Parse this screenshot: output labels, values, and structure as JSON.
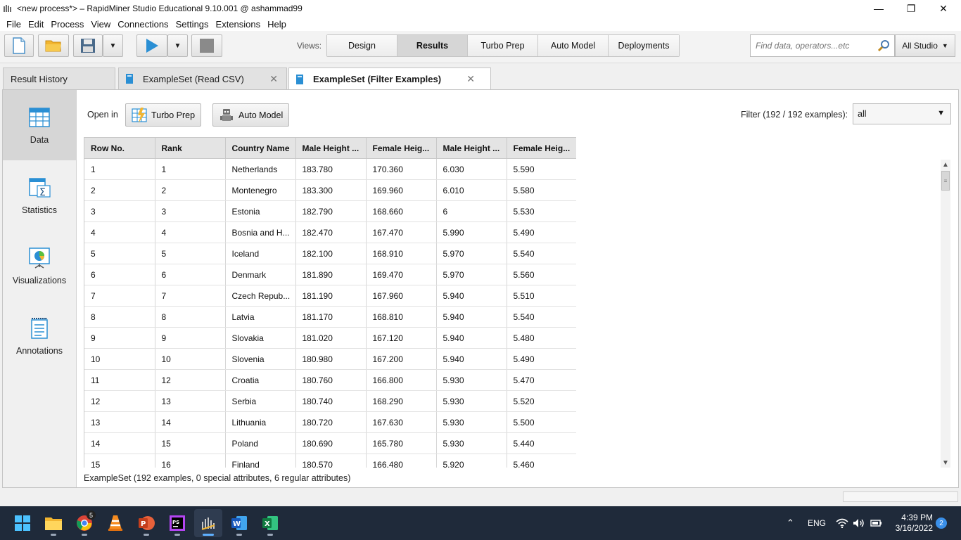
{
  "window": {
    "title": "<new process*> – RapidMiner Studio Educational 9.10.001 @ ashammad99",
    "minimize_glyph": "—",
    "restore_glyph": "❐",
    "close_glyph": "✕"
  },
  "menu": {
    "file": "File",
    "edit": "Edit",
    "process": "Process",
    "view": "View",
    "connections": "Connections",
    "settings": "Settings",
    "extensions": "Extensions",
    "help": "Help"
  },
  "toolbar": {
    "views_label": "Views:",
    "views": [
      "Design",
      "Results",
      "Turbo Prep",
      "Auto Model",
      "Deployments"
    ],
    "active_view": "Results",
    "search_placeholder": "Find data, operators...etc",
    "scope": "All Studio"
  },
  "tabs": {
    "result_history": "Result History",
    "read_csv": "ExampleSet (Read CSV)",
    "filter_examples": "ExampleSet (Filter Examples)"
  },
  "sidenav": {
    "data": "Data",
    "statistics": "Statistics",
    "visualizations": "Visualizations",
    "annotations": "Annotations"
  },
  "actions": {
    "open_in": "Open in",
    "turbo_prep": "Turbo Prep",
    "auto_model": "Auto Model",
    "filter_label": "Filter (192 / 192 examples):",
    "filter_value": "all"
  },
  "table": {
    "columns": [
      "Row No.",
      "Rank",
      "Country Name",
      "Male Height ...",
      "Female Heig...",
      "Male Height ...",
      "Female Heig..."
    ],
    "rows": [
      [
        "1",
        "1",
        "Netherlands",
        "183.780",
        "170.360",
        "6.030",
        "5.590"
      ],
      [
        "2",
        "2",
        "Montenegro",
        "183.300",
        "169.960",
        "6.010",
        "5.580"
      ],
      [
        "3",
        "3",
        "Estonia",
        "182.790",
        "168.660",
        "6",
        "5.530"
      ],
      [
        "4",
        "4",
        "Bosnia and H...",
        "182.470",
        "167.470",
        "5.990",
        "5.490"
      ],
      [
        "5",
        "5",
        "Iceland",
        "182.100",
        "168.910",
        "5.970",
        "5.540"
      ],
      [
        "6",
        "6",
        "Denmark",
        "181.890",
        "169.470",
        "5.970",
        "5.560"
      ],
      [
        "7",
        "7",
        "Czech Repub...",
        "181.190",
        "167.960",
        "5.940",
        "5.510"
      ],
      [
        "8",
        "8",
        "Latvia",
        "181.170",
        "168.810",
        "5.940",
        "5.540"
      ],
      [
        "9",
        "9",
        "Slovakia",
        "181.020",
        "167.120",
        "5.940",
        "5.480"
      ],
      [
        "10",
        "10",
        "Slovenia",
        "180.980",
        "167.200",
        "5.940",
        "5.490"
      ],
      [
        "11",
        "12",
        "Croatia",
        "180.760",
        "166.800",
        "5.930",
        "5.470"
      ],
      [
        "12",
        "13",
        "Serbia",
        "180.740",
        "168.290",
        "5.930",
        "5.520"
      ],
      [
        "13",
        "14",
        "Lithuania",
        "180.720",
        "167.630",
        "5.930",
        "5.500"
      ],
      [
        "14",
        "15",
        "Poland",
        "180.690",
        "165.780",
        "5.930",
        "5.440"
      ],
      [
        "15",
        "16",
        "Finland",
        "180.570",
        "166.480",
        "5.920",
        "5.460"
      ]
    ]
  },
  "status": {
    "text": "ExampleSet (192 examples, 0 special attributes, 6 regular attributes)"
  },
  "taskbar": {
    "chrome_badge": "5",
    "language": "ENG",
    "time": "4:39 PM",
    "date": "3/16/2022",
    "notifications": "2"
  },
  "colors": {
    "accent_blue": "#2a8fd4",
    "taskbar": "#1f2a3a",
    "active_view_bg": "#d6d6d6"
  },
  "icons": {
    "app": "rapidminer-icon",
    "new": "new-file-icon",
    "open": "folder-open-icon",
    "save": "save-icon",
    "run": "play-icon",
    "stop": "stop-icon",
    "search": "magnifier-icon"
  }
}
